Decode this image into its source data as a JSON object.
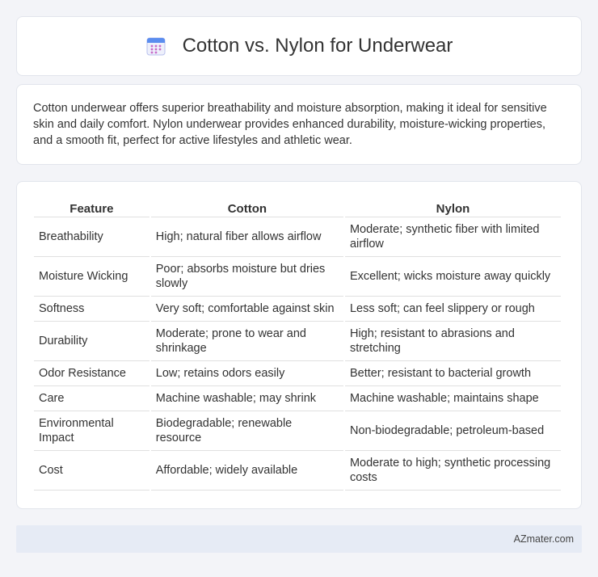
{
  "header": {
    "title": "Cotton vs. Nylon for Underwear",
    "icon": "calendar-icon"
  },
  "intro": {
    "text": "Cotton underwear offers superior breathability and moisture absorption, making it ideal for sensitive skin and daily comfort. Nylon underwear provides enhanced durability, moisture-wicking properties, and a smooth fit, perfect for active lifestyles and athletic wear."
  },
  "table": {
    "headers": [
      "Feature",
      "Cotton",
      "Nylon"
    ],
    "rows": [
      [
        "Breathability",
        "High; natural fiber allows airflow",
        "Moderate; synthetic fiber with limited airflow"
      ],
      [
        "Moisture Wicking",
        "Poor; absorbs moisture but dries slowly",
        "Excellent; wicks moisture away quickly"
      ],
      [
        "Softness",
        "Very soft; comfortable against skin",
        "Less soft; can feel slippery or rough"
      ],
      [
        "Durability",
        "Moderate; prone to wear and shrinkage",
        "High; resistant to abrasions and stretching"
      ],
      [
        "Odor Resistance",
        "Low; retains odors easily",
        "Better; resistant to bacterial growth"
      ],
      [
        "Care",
        "Machine washable; may shrink",
        "Machine washable; maintains shape"
      ],
      [
        "Environmental Impact",
        "Biodegradable; renewable resource",
        "Non-biodegradable; petroleum-based"
      ],
      [
        "Cost",
        "Affordable; widely available",
        "Moderate to high; synthetic processing costs"
      ]
    ]
  },
  "footer": {
    "text": "AZmater.com"
  }
}
